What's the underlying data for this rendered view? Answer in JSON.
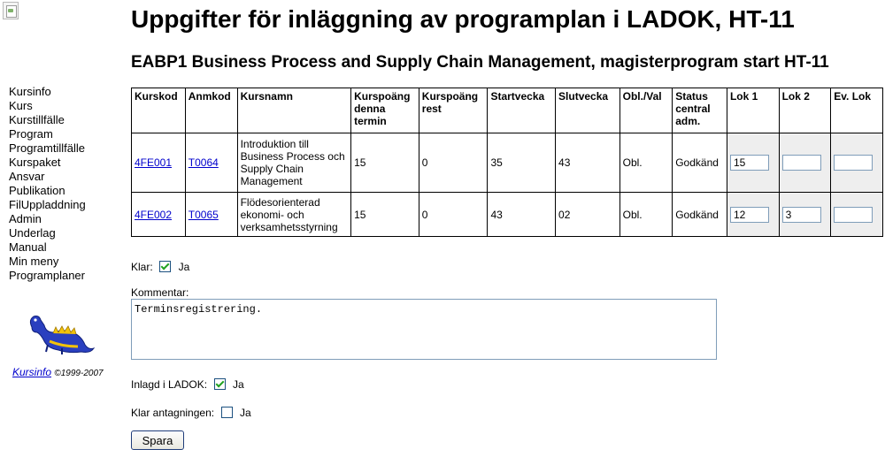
{
  "sidebar": {
    "items": [
      {
        "label": "Kursinfo"
      },
      {
        "label": "Kurs"
      },
      {
        "label": "Kurstillfälle"
      },
      {
        "label": "Program"
      },
      {
        "label": "Programtillfälle"
      },
      {
        "label": "Kurspaket"
      },
      {
        "label": "Ansvar"
      },
      {
        "label": "Publikation"
      },
      {
        "label": "FilUppladdning"
      },
      {
        "label": "Admin"
      },
      {
        "label": "Underlag"
      },
      {
        "label": "Manual"
      },
      {
        "label": "Min meny"
      },
      {
        "label": "Programplaner"
      }
    ],
    "credit_link": "Kursinfo",
    "credit_text": "©1999-2007"
  },
  "page": {
    "title": "Uppgifter för inläggning av programplan i LADOK, HT-11",
    "subtitle": "EABP1 Business Process and Supply Chain Management, magisterprogram start HT-11"
  },
  "table": {
    "headers": [
      "Kurskod",
      "Anmkod",
      "Kursnamn",
      "Kurspoäng denna termin",
      "Kurspoäng rest",
      "Startvecka",
      "Slutvecka",
      "Obl./Val",
      "Status central adm.",
      "Lok 1",
      "Lok 2",
      "Ev. Lok"
    ],
    "rows": [
      {
        "kurskod": "4FE001",
        "anmkod": "T0064",
        "kursnamn": "Introduktion till Business Process och Supply Chain Management",
        "poang": "15",
        "rest": "0",
        "start": "35",
        "slut": "43",
        "obl": "Obl.",
        "status": "Godkänd",
        "lok1": "15",
        "lok2": "",
        "evlok": ""
      },
      {
        "kurskod": "4FE002",
        "anmkod": "T0065",
        "kursnamn": "Flödesorienterad ekonomi- och verksamhetsstyrning",
        "poang": "15",
        "rest": "0",
        "start": "43",
        "slut": "02",
        "obl": "Obl.",
        "status": "Godkänd",
        "lok1": "12",
        "lok2": "3",
        "evlok": ""
      }
    ]
  },
  "form": {
    "klar_label": "Klar:",
    "klar_option": "Ja",
    "klar_checked": true,
    "kommentar_label": "Kommentar:",
    "kommentar_value": "Terminsregistrering.",
    "ladok_label": "Inlagd i LADOK:",
    "ladok_option": "Ja",
    "ladok_checked": true,
    "antag_label": "Klar antagningen:",
    "antag_option": "Ja",
    "antag_checked": false,
    "save_label": "Spara"
  },
  "colors": {
    "link": "#0000cc",
    "lok_bg": "#eeeeee",
    "check": "#21a121"
  }
}
